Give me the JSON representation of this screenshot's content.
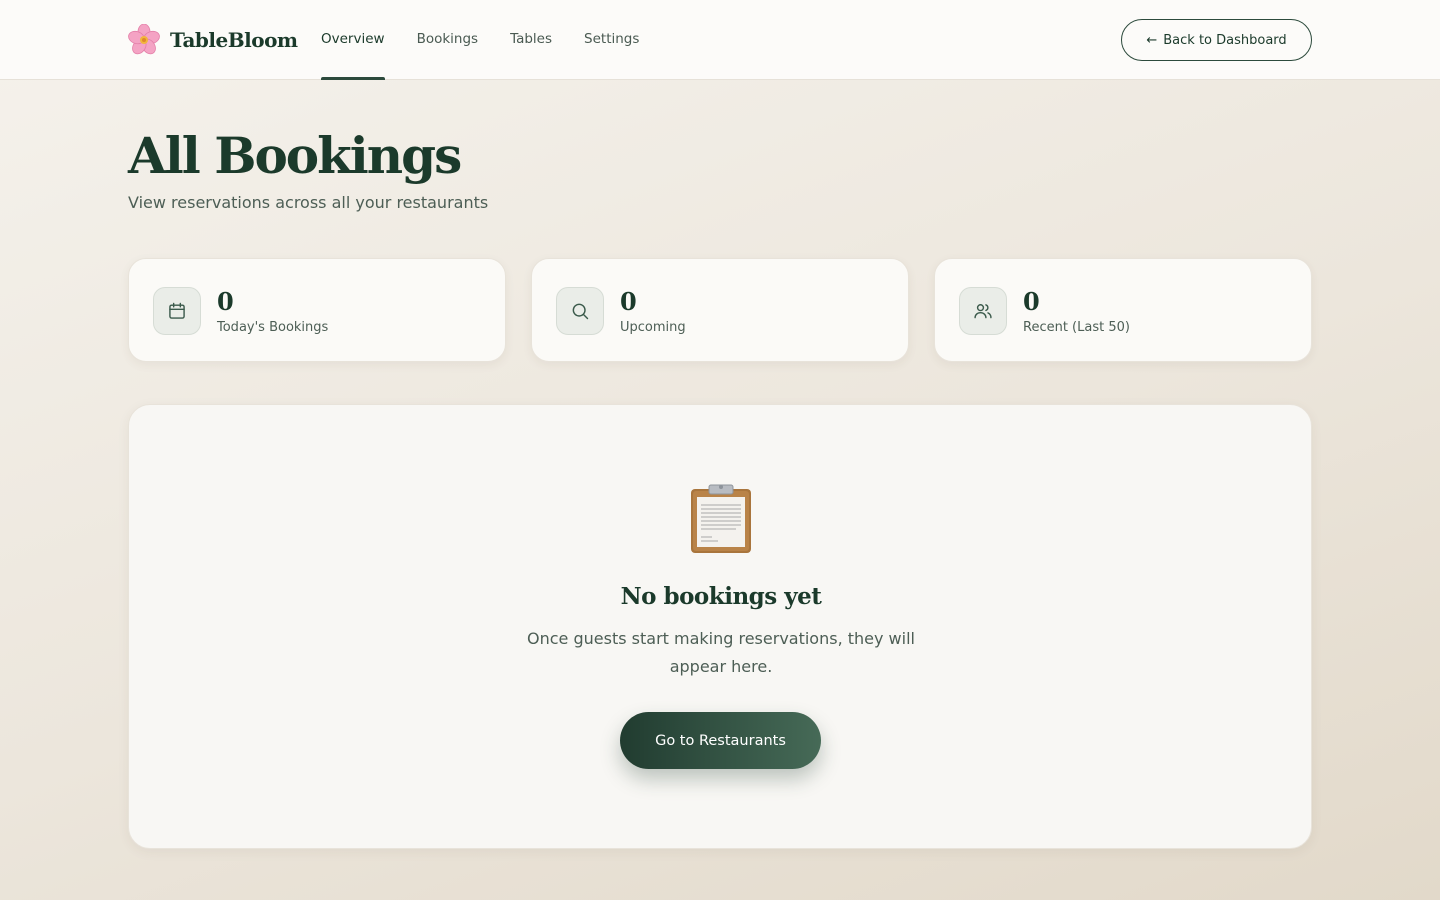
{
  "app": {
    "name": "TableBloom",
    "logo_icon": "cherry-blossom-icon"
  },
  "nav": {
    "items": [
      {
        "label": "Overview",
        "active": true
      },
      {
        "label": "Bookings",
        "active": false
      },
      {
        "label": "Tables",
        "active": false
      },
      {
        "label": "Settings",
        "active": false
      }
    ],
    "back_button": {
      "arrow": "←",
      "label": "Back to Dashboard",
      "icon": "arrow-left-icon"
    }
  },
  "page": {
    "title": "All Bookings",
    "subtitle": "View reservations across all your restaurants"
  },
  "stats": [
    {
      "value": "0",
      "label": "Today's Bookings",
      "icon": "calendar-icon"
    },
    {
      "value": "0",
      "label": "Upcoming",
      "icon": "search-icon"
    },
    {
      "value": "0",
      "label": "Recent (Last 50)",
      "icon": "users-icon"
    }
  ],
  "empty_state": {
    "icon": "clipboard-icon",
    "title": "No bookings yet",
    "text": "Once guests start making reservations, they will appear here.",
    "button_label": "Go to Restaurants"
  },
  "colors": {
    "primary": "#1b3a2b",
    "accent_gradient_start": "#213c30",
    "accent_gradient_end": "#466a57",
    "background": "#f5f2ec",
    "card": "#fbfaf7"
  }
}
